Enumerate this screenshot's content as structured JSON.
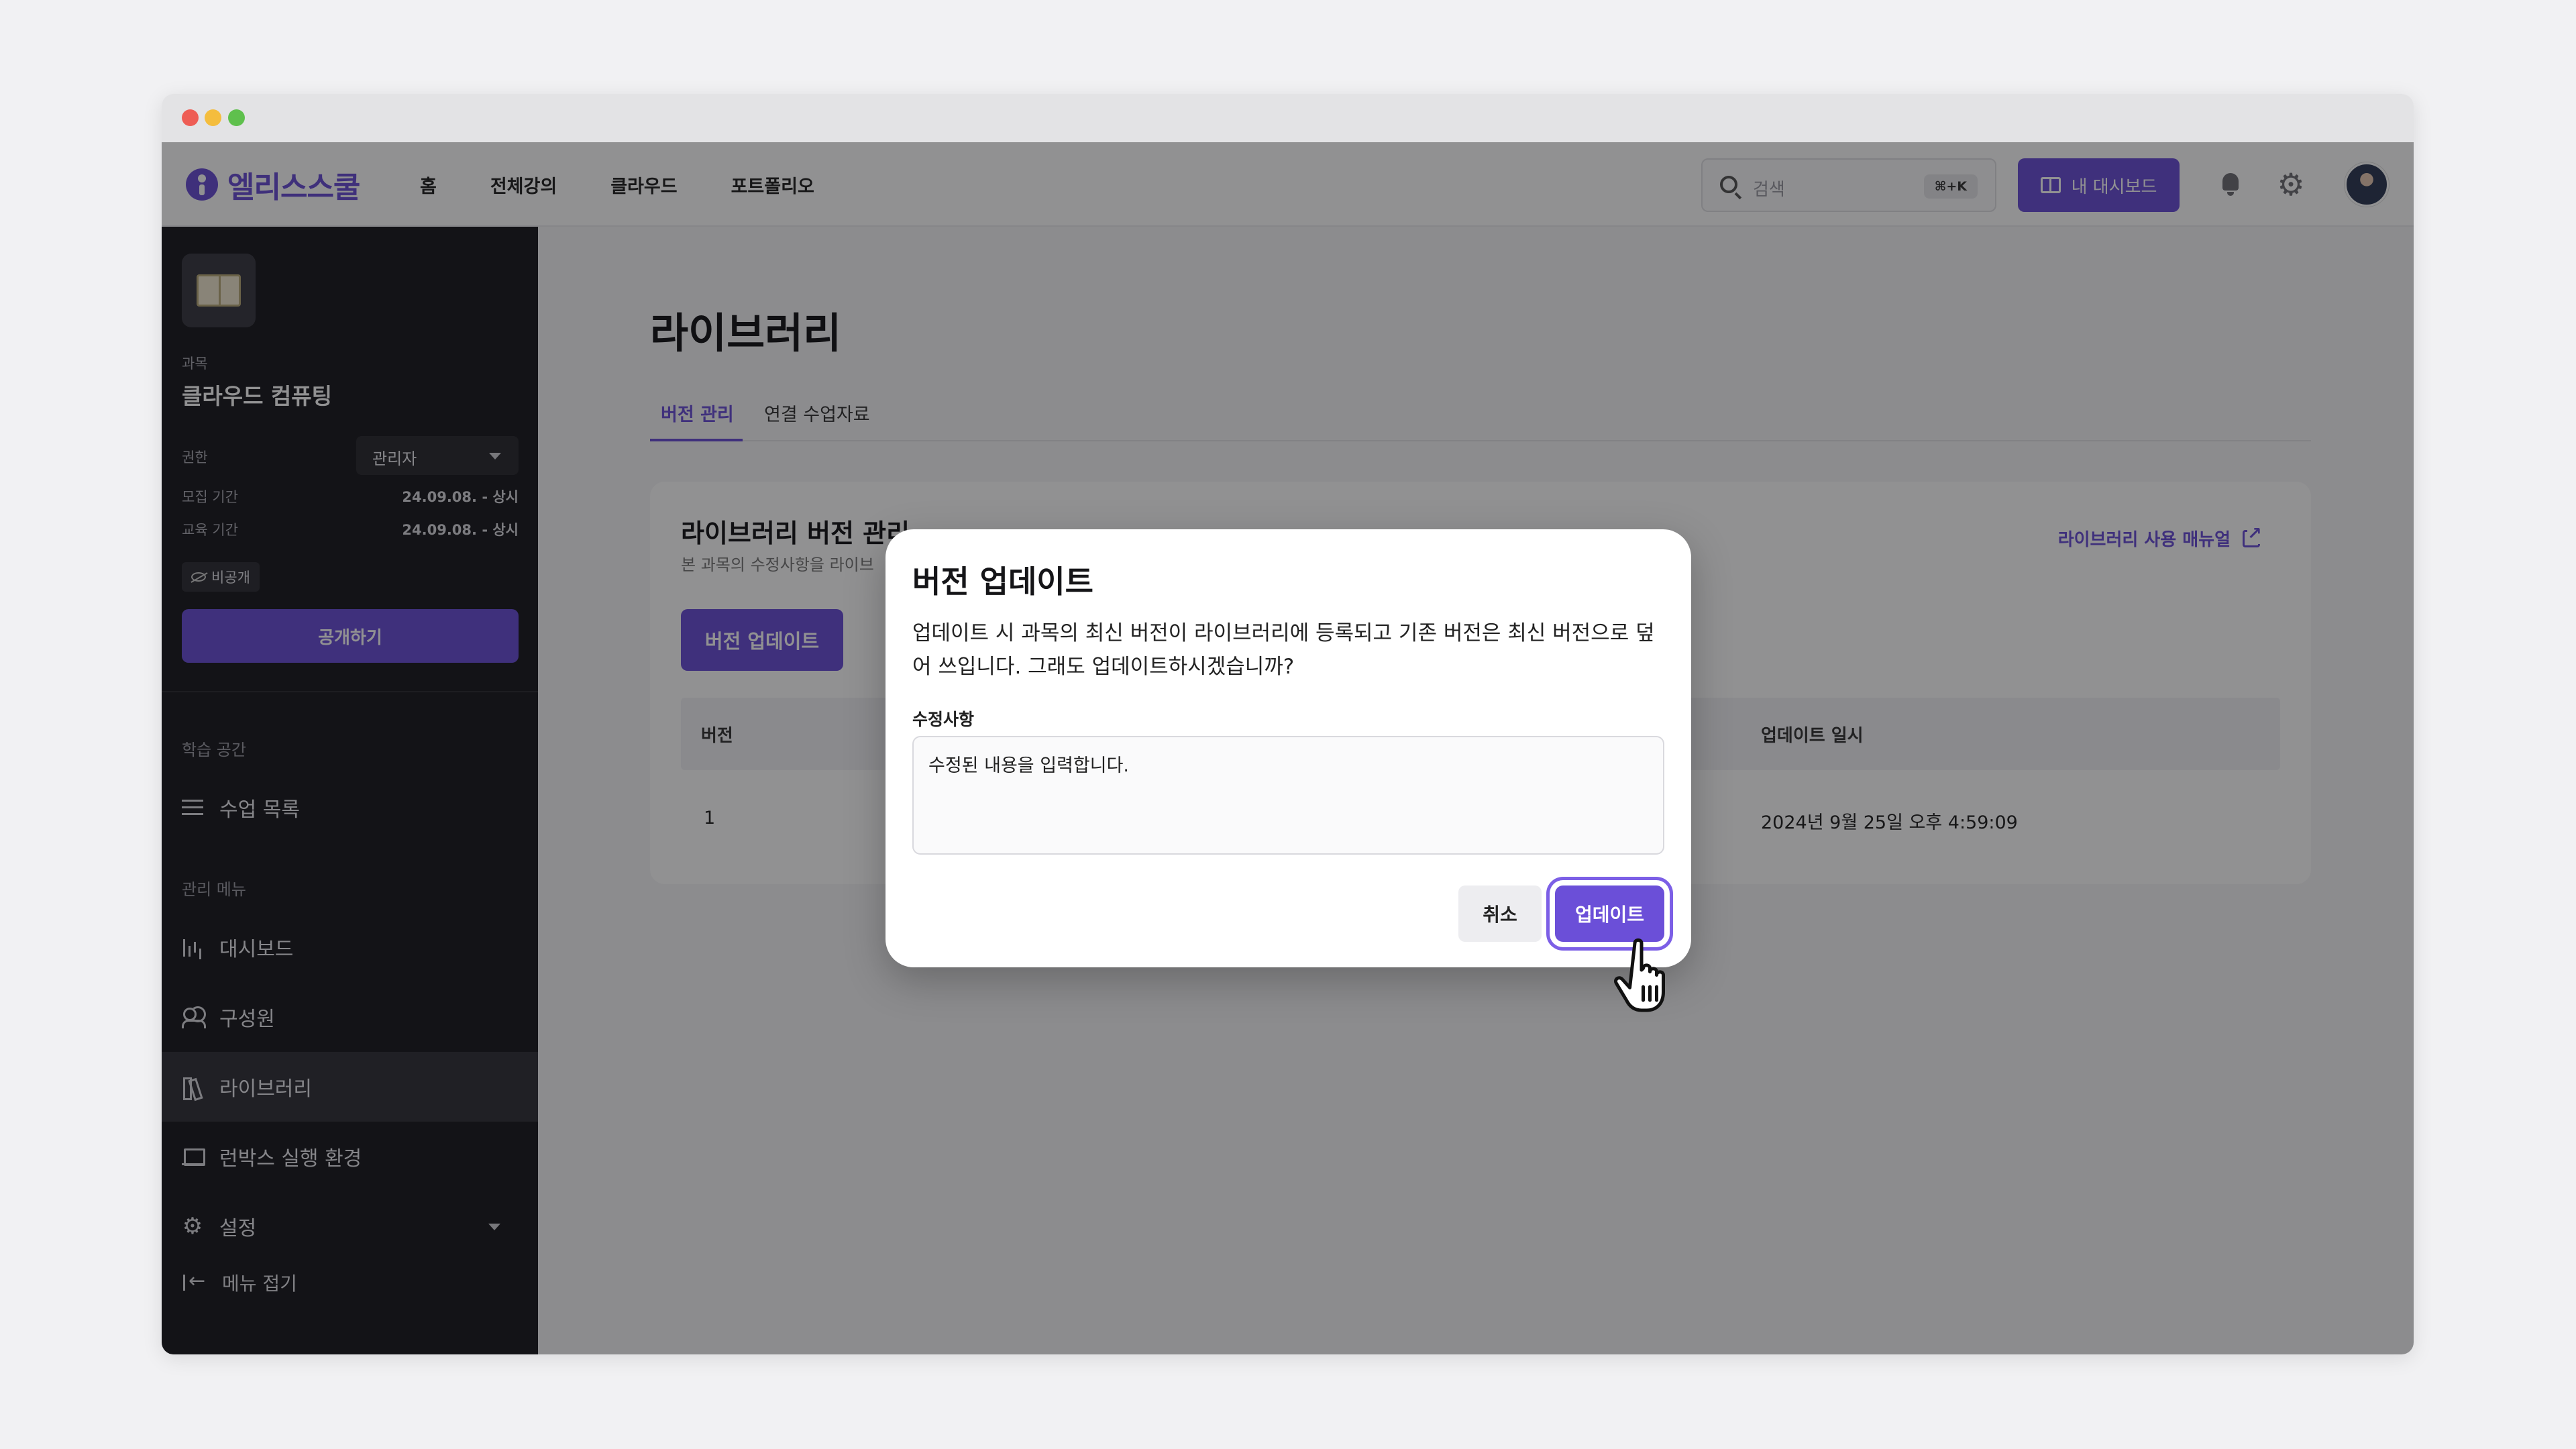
{
  "app": {
    "logo_text": "엘리스스쿨",
    "nav": [
      "홈",
      "전체강의",
      "클라우드",
      "포트폴리오"
    ],
    "search": {
      "placeholder": "검색",
      "shortcut": "⌘+K"
    },
    "dashboard_button": "내 대시보드"
  },
  "sidebar": {
    "course_label": "과목",
    "course_title": "클라우드 컴퓨팅",
    "role_label": "권한",
    "role_value": "관리자",
    "recruit_label": "모집 기간",
    "recruit_value": "24.09.08. - 상시",
    "edu_label": "교육 기간",
    "edu_value": "24.09.08. - 상시",
    "visibility_badge": "비공개",
    "publish_button": "공개하기",
    "section_learning": "학습 공간",
    "section_admin": "관리 메뉴",
    "items": [
      {
        "label": "수업 목록",
        "icon": "list-icon"
      },
      {
        "label": "대시보드",
        "icon": "bar-chart-icon"
      },
      {
        "label": "구성원",
        "icon": "users-icon"
      },
      {
        "label": "라이브러리",
        "icon": "library-icon",
        "active": true
      },
      {
        "label": "런박스 실행 환경",
        "icon": "laptop-icon"
      },
      {
        "label": "설정",
        "icon": "gear-icon"
      }
    ],
    "collapse_label": "메뉴 접기"
  },
  "main": {
    "page_title": "라이브러리",
    "tabs": [
      "버전 관리",
      "연결 수업자료"
    ],
    "card": {
      "title": "라이브러리 버전 관리",
      "subtitle": "본 과목의 수정사항을 라이브",
      "manual_link": "라이브러리 사용 매뉴얼",
      "update_button": "버전 업데이트",
      "columns": [
        "버전",
        "업데이트 일시"
      ],
      "rows": [
        {
          "version": "1",
          "updated_at": "2024년 9월 25일 오후 4:59:09"
        }
      ]
    }
  },
  "modal": {
    "title": "버전 업데이트",
    "description": "업데이트 시 과목의 최신 버전이 라이브러리에 등록되고 기존 버전은 최신 버전으로 덮어 쓰입니다. 그래도 업데이트하시겠습니까?",
    "field_label": "수정사항",
    "field_value": "수정된 내용을 입력합니다.",
    "cancel": "취소",
    "confirm": "업데이트"
  },
  "colors": {
    "accent": "#6b4fd8",
    "sidebar_bg": "#1b1b1f"
  }
}
